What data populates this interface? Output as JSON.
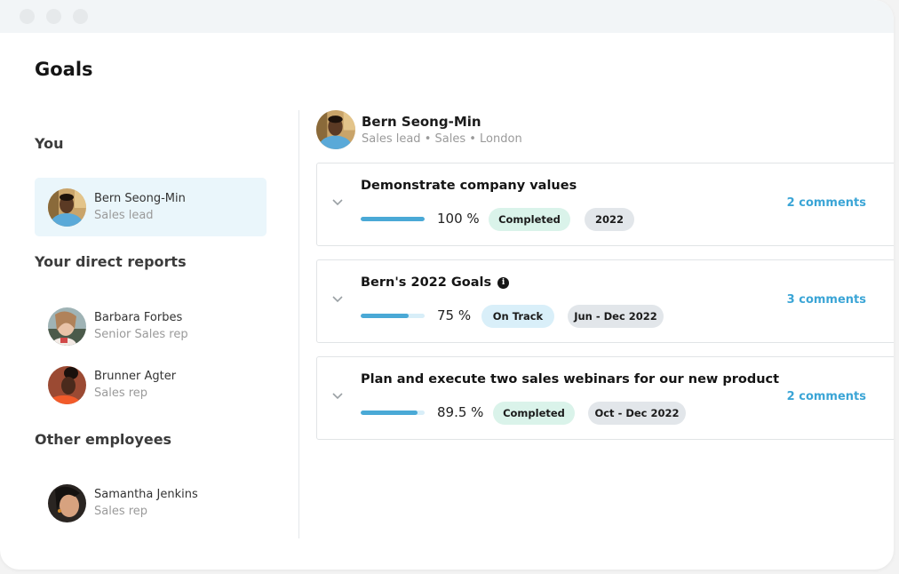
{
  "window": {
    "controls": [
      "close",
      "minimize",
      "maximize"
    ]
  },
  "page": {
    "title": "Goals"
  },
  "sidebar": {
    "you_heading": "You",
    "you": {
      "name": "Bern Seong-Min",
      "role": "Sales lead",
      "selected": true,
      "avatar": "avatar-bern"
    },
    "direct_reports_heading": "Your direct reports",
    "direct_reports": [
      {
        "name": "Barbara Forbes",
        "role": "Senior Sales rep",
        "avatar": "avatar-barbara"
      },
      {
        "name": "Brunner Agter",
        "role": "Sales rep",
        "avatar": "avatar-brunner"
      }
    ],
    "other_heading": "Other employees",
    "others": [
      {
        "name": "Samantha Jenkins",
        "role": "Sales rep",
        "avatar": "avatar-samantha"
      }
    ]
  },
  "main": {
    "person": {
      "name": "Bern Seong-Min",
      "subtitle": "Sales lead • Sales • London"
    },
    "goals": [
      {
        "title": "Demonstrate company values",
        "has_info_icon": false,
        "progress": 100,
        "progress_label": "100 %",
        "status": "Completed",
        "status_type": "completed",
        "period": "2022",
        "comments": "2 comments"
      },
      {
        "title": "Bern's 2022 Goals",
        "has_info_icon": true,
        "progress": 75,
        "progress_label": "75 %",
        "status": "On Track",
        "status_type": "ontrack",
        "period": "Jun - Dec 2022",
        "comments": "3 comments"
      },
      {
        "title": "Plan and execute two sales webinars for our new product",
        "has_info_icon": false,
        "progress": 89.5,
        "progress_label": "89.5 %",
        "status": "Completed",
        "status_type": "completed",
        "period": "Oct - Dec 2022",
        "comments": "2 comments"
      }
    ]
  },
  "colors": {
    "accent": "#3ba5d6",
    "progress_fill": "#4aa9d6",
    "progress_track": "#d8eef8",
    "completed_bg": "#daf3ea",
    "ontrack_bg": "#d9eff9",
    "period_bg": "#e2e6ea",
    "selected_bg": "#eaf6fb"
  },
  "icons": {
    "chevron": "chevron-down-icon",
    "info": "info-icon"
  }
}
